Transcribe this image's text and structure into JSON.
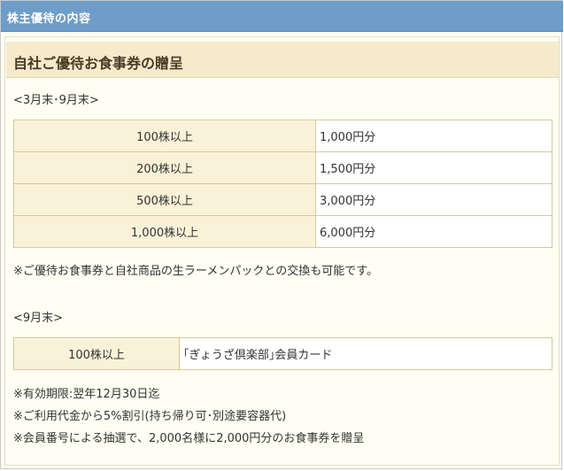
{
  "header": {
    "title": "株主優待の内容"
  },
  "section": {
    "heading": "自社ご優待お食事券の贈呈"
  },
  "period1": {
    "label": "<3月末･9月末>",
    "rows": [
      {
        "shares": "100株以上",
        "benefit": "1,000円分"
      },
      {
        "shares": "200株以上",
        "benefit": "1,500円分"
      },
      {
        "shares": "500株以上",
        "benefit": "3,000円分"
      },
      {
        "shares": "1,000株以上",
        "benefit": "6,000円分"
      }
    ],
    "note": "※ご優待お食事券と自社商品の生ラーメンパックとの交換も可能です。"
  },
  "period2": {
    "label": "<9月末>",
    "rows": [
      {
        "shares": "100株以上",
        "benefit": "｢ぎょうざ倶楽部｣会員カード"
      }
    ],
    "notes": [
      "※有効期限:翌年12月30日迄",
      "※ご利用代金から5%割引(持ち帰り可･別途要容器代)",
      "※会員番号による抽選で、2,000名様に2,000円分のお食事券を贈呈"
    ]
  }
}
